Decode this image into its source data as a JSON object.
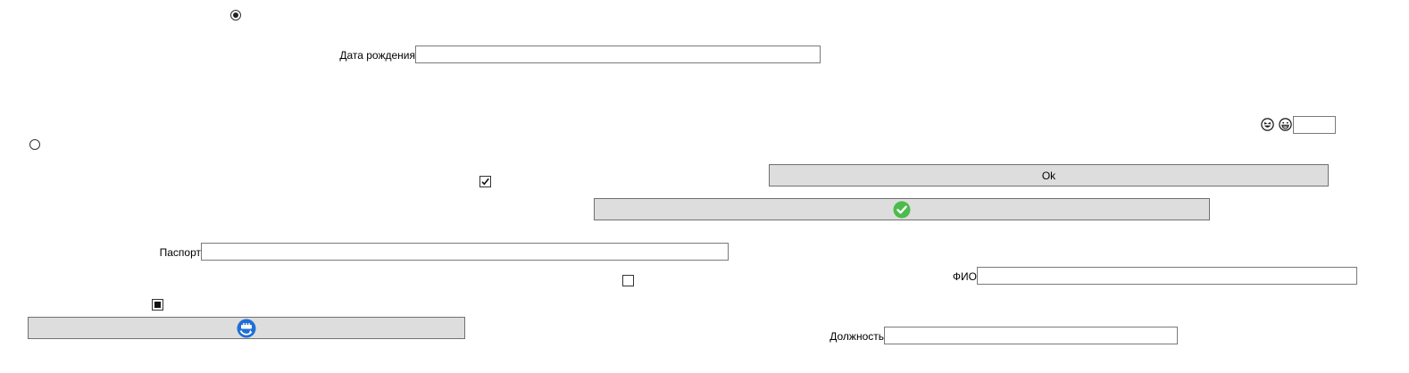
{
  "form": {
    "birth_date": {
      "label": "Дата рождения",
      "value": ""
    },
    "passport": {
      "label": "Паспорт",
      "value": ""
    },
    "full_name": {
      "label": "ФИО",
      "value": ""
    },
    "position": {
      "label": "Должность",
      "value": ""
    },
    "small_field": {
      "value": ""
    }
  },
  "radios": {
    "top": {
      "checked": true
    },
    "left": {
      "checked": false
    }
  },
  "checkboxes": {
    "middle": {
      "state": "checked"
    },
    "lower": {
      "state": "unchecked"
    },
    "left": {
      "state": "indeterminate"
    }
  },
  "buttons": {
    "ok": {
      "label": "Ok"
    },
    "confirm": {
      "icon": "green-check-circle-icon"
    },
    "refresh": {
      "icon": "blue-refresh-icon"
    }
  },
  "emoji_icons": [
    "laughing-emoji-icon",
    "grinning-emoji-icon"
  ],
  "colors": {
    "button_bg": "#dddddd",
    "check_green": "#4cbb4c",
    "refresh_blue": "#1f6fd6"
  }
}
